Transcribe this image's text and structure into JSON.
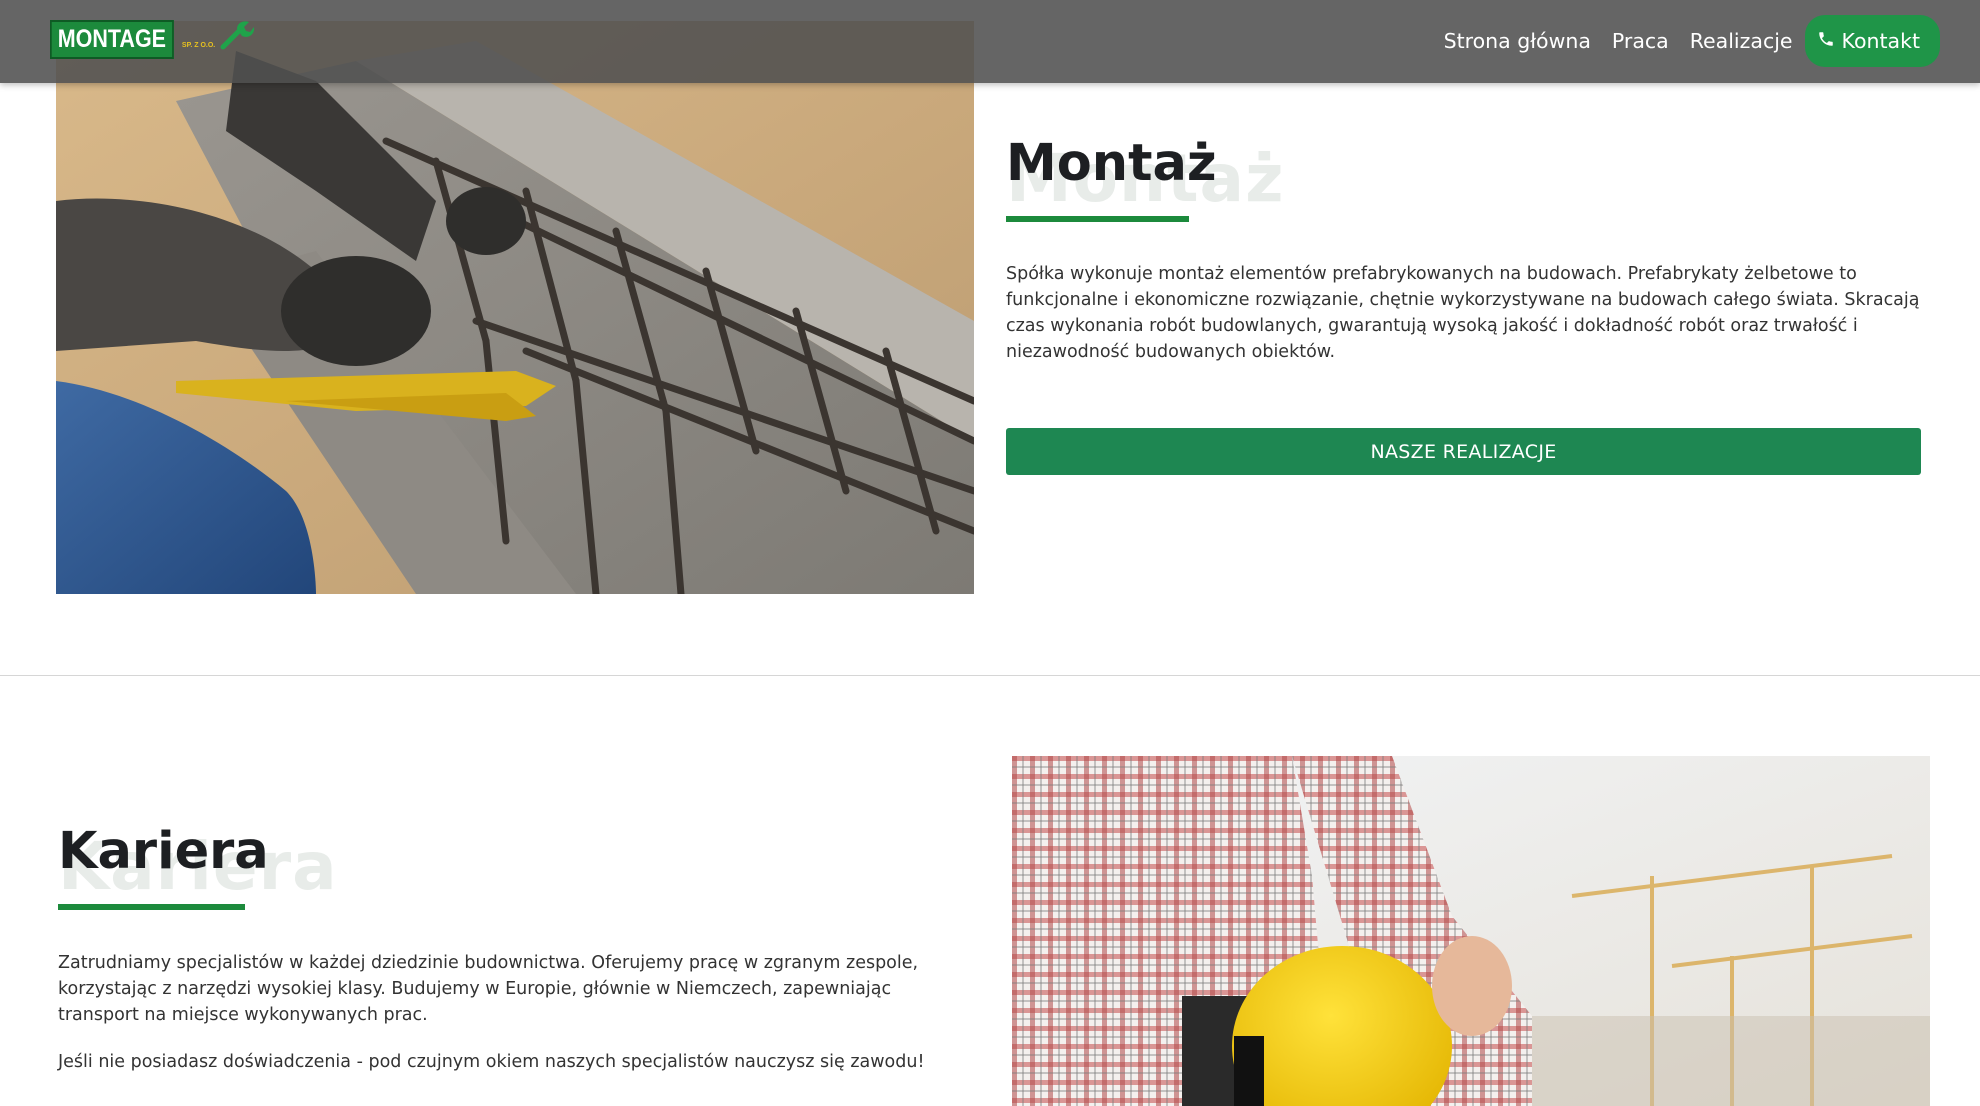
{
  "header": {
    "logo_text": "MONTAGE",
    "logo_sub": "SP. Z O.O.",
    "nav": [
      "Strona główna",
      "Praca",
      "Realizacje"
    ],
    "cta_label": "Kontakt"
  },
  "section_montaz": {
    "title": "Montaż",
    "ghost_title": "Montaż",
    "paragraph": "Spółka wykonuje montaż elementów prefabrykowanych na budowach. Prefabrykaty żelbetowe to funkcjonalne i ekonomiczne rozwiązanie, chętnie wykorzystywane na budowach całego świata. Skracają czas wykonania robót budowlanych, gwarantują wysoką jakość i dokładność robót oraz trwałość i niezawodność budowanych obiektów.",
    "button_label": "NASZE REALIZACJE"
  },
  "section_kariera": {
    "title": "Kariera",
    "ghost_title": "Kariera",
    "paragraph1": "Zatrudniamy specjalistów w każdej dziedzinie budownictwa. Oferujemy pracę w zgranym zespole, korzystając z narzędzi wysokiej klasy. Budujemy w Europie, głównie w Niemczech, zapewniając transport na miejsce wykonywanych prac.",
    "paragraph2": "Jeśli nie posiadasz doświadczenia - pod czujnym okiem naszych specjalistów nauczysz się zawodu!"
  },
  "colors": {
    "brand_green": "#1c8a3c",
    "header_bg": "#505050",
    "button_green": "#1e8752"
  },
  "icons": {
    "logo": "wrench-icon",
    "cta": "phone-icon"
  }
}
